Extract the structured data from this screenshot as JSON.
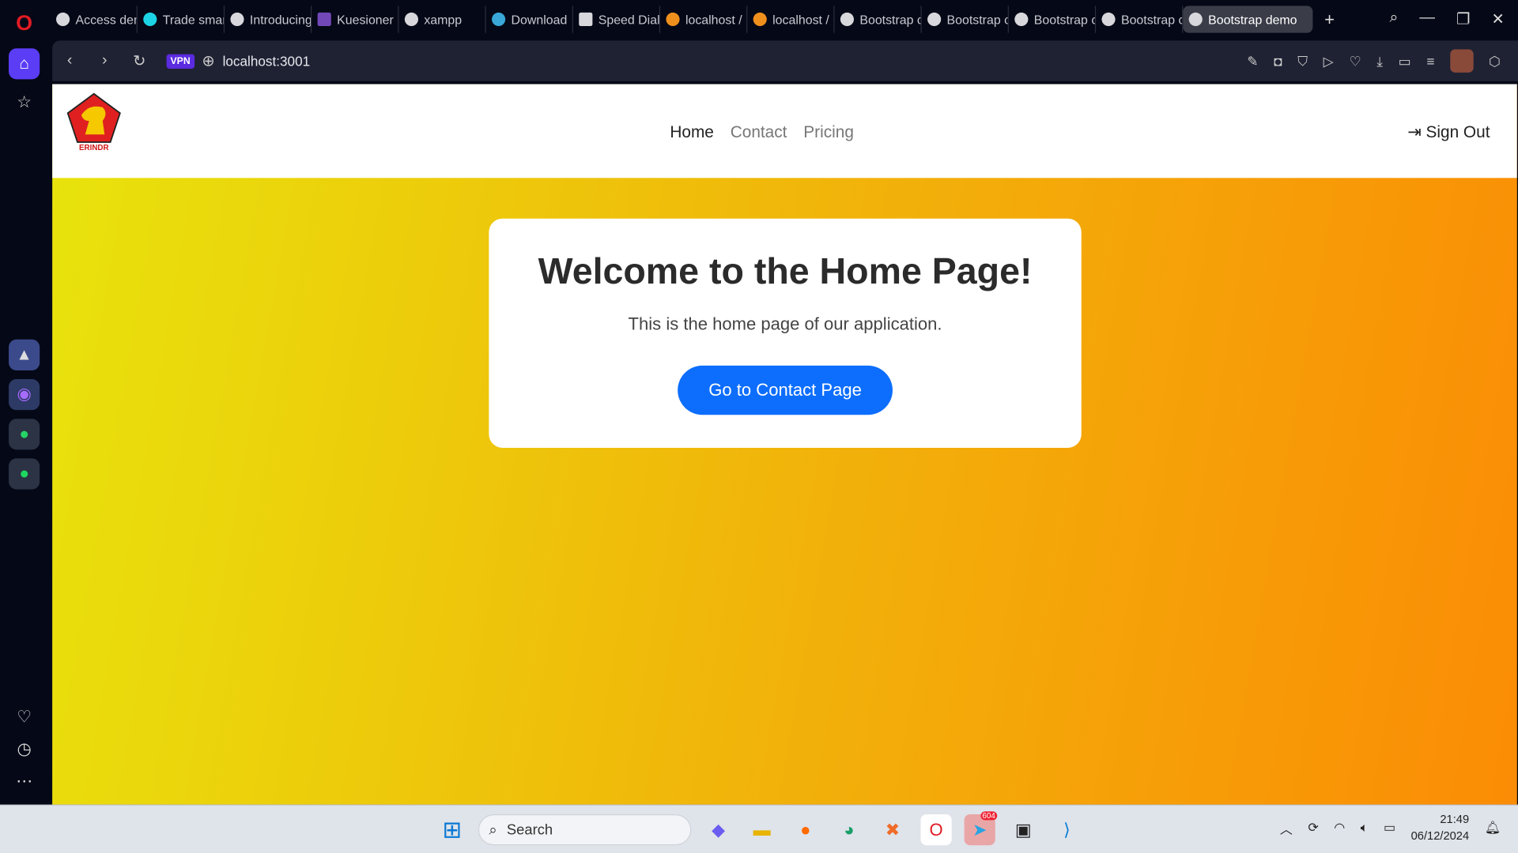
{
  "browser": {
    "tabs": [
      {
        "label": "Access den"
      },
      {
        "label": "Trade smar"
      },
      {
        "label": "Introducing"
      },
      {
        "label": "Kuesioner"
      },
      {
        "label": "xampp"
      },
      {
        "label": "Download"
      },
      {
        "label": "Speed Dial"
      },
      {
        "label": "localhost /"
      },
      {
        "label": "localhost /"
      },
      {
        "label": "Bootstrap c"
      },
      {
        "label": "Bootstrap c"
      },
      {
        "label": "Bootstrap c"
      },
      {
        "label": "Bootstrap c"
      },
      {
        "label": "Bootstrap demo",
        "active": true
      }
    ],
    "vpn_label": "VPN",
    "url": "localhost:3001"
  },
  "site": {
    "logo_text": "GERINDRA",
    "nav": [
      {
        "label": "Home",
        "active": true
      },
      {
        "label": "Contact"
      },
      {
        "label": "Pricing"
      }
    ],
    "sign_out": "Sign Out",
    "card": {
      "title": "Welcome to the Home Page!",
      "text": "This is the home page of our application.",
      "button": "Go to Contact Page"
    },
    "accent": "#0d6efd"
  },
  "taskbar": {
    "search_placeholder": "Search",
    "telegram_badge": "604",
    "time": "21:49",
    "date": "06/12/2024"
  }
}
